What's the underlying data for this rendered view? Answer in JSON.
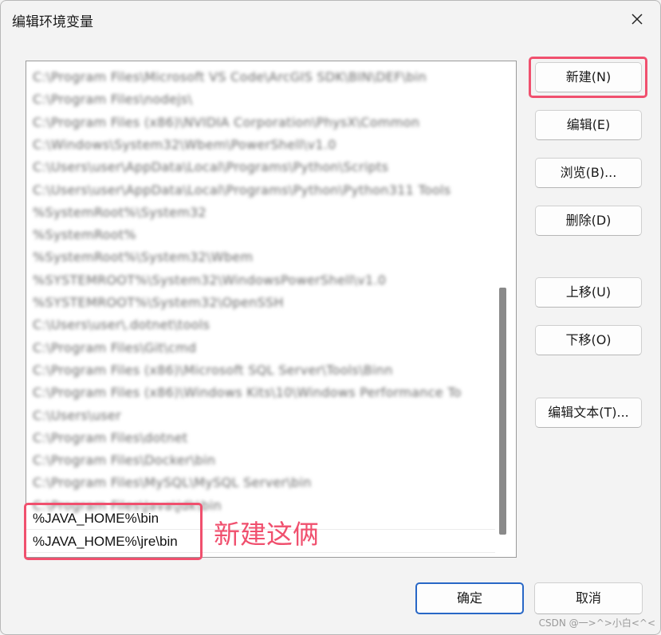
{
  "window": {
    "title": "编辑环境变量",
    "close_icon": "close-icon"
  },
  "path_list": {
    "blurred_items": [
      "C:\\Program Files\\Microsoft VS Code\\ArcGIS SDK\\BIN\\DEF\\bin",
      "C:\\Program Files\\nodejs\\",
      "C:\\Program Files (x86)\\NVIDIA Corporation\\PhysX\\Common",
      "C:\\Windows\\System32\\Wbem\\PowerShell\\v1.0",
      "C:\\Users\\user\\AppData\\Local\\Programs\\Python\\Scripts",
      "C:\\Users\\user\\AppData\\Local\\Programs\\Python\\Python311 Tools",
      "%SystemRoot%\\System32",
      "%SystemRoot%",
      "%SystemRoot%\\System32\\Wbem",
      "%SYSTEMROOT%\\System32\\WindowsPowerShell\\v1.0",
      "%SYSTEMROOT%\\System32\\OpenSSH",
      "C:\\Users\\user\\.dotnet\\tools",
      "C:\\Program Files\\Git\\cmd",
      "C:\\Program Files (x86)\\Microsoft SQL Server\\Tools\\Binn",
      "C:\\Program Files (x86)\\Windows Kits\\10\\Windows Performance To",
      "C:\\Users\\user",
      "C:\\Program Files\\dotnet",
      "C:\\Program Files\\Docker\\bin",
      "C:\\Program Files\\MySQL\\MySQL Server\\bin",
      "C:\\Program Files\\Java\\jdk\\bin"
    ],
    "new_items": [
      "%JAVA_HOME%\\bin",
      "%JAVA_HOME%\\jre\\bin"
    ]
  },
  "buttons": {
    "new": "新建(N)",
    "edit": "编辑(E)",
    "browse": "浏览(B)...",
    "delete": "删除(D)",
    "move_up": "上移(U)",
    "move_down": "下移(O)",
    "edit_text": "编辑文本(T)...",
    "ok": "确定",
    "cancel": "取消"
  },
  "annotation": {
    "text": "新建这俩",
    "color": "#f0506e"
  },
  "watermark": "CSDN @一>^>小白<^<"
}
